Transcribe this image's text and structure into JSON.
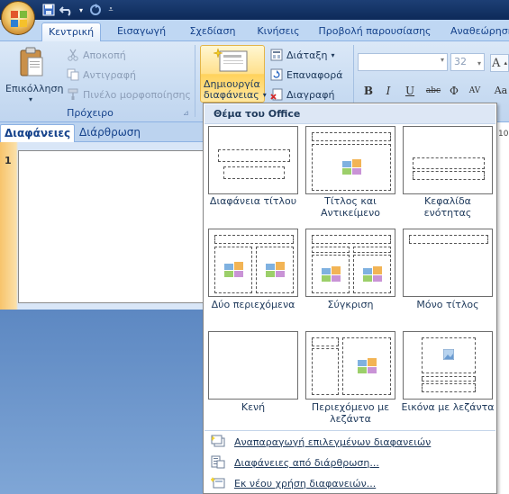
{
  "tabs": [
    {
      "label": "Κεντρική",
      "active": true
    },
    {
      "label": "Εισαγωγή"
    },
    {
      "label": "Σχεδίαση"
    },
    {
      "label": "Κινήσεις"
    },
    {
      "label": "Προβολή παρουσίασης"
    },
    {
      "label": "Αναθεώρηση"
    }
  ],
  "clipboard": {
    "paste_label": "Επικόλληση",
    "cut_label": "Αποκοπή",
    "copy_label": "Αντιγραφή",
    "format_painter_label": "Πινέλο μορφοποίησης",
    "group_label": "Πρόχειρο"
  },
  "slides": {
    "new_slide_label_line1": "Δημιουργία",
    "new_slide_label_line2": "διαφάνειας",
    "layout_label": "Διάταξη",
    "reset_label": "Επαναφορά",
    "delete_label": "Διαγραφή"
  },
  "font": {
    "name_value": "",
    "size_value": "32",
    "bold": "B",
    "italic": "I",
    "underline": "U",
    "strike": "abc",
    "shadow": "S",
    "spacing": "AV",
    "case": "Aa"
  },
  "left_panel": {
    "tab_slides": "Διαφάνειες",
    "tab_outline": "Διάρθρωση",
    "slide_number": "1"
  },
  "ruler_value": "10",
  "dropdown": {
    "header": "Θέμα του Office",
    "layouts": [
      {
        "label": "Διαφάνεια τίτλου"
      },
      {
        "label": "Τίτλος και Αντικείμενο"
      },
      {
        "label": "Κεφαλίδα ενότητας"
      },
      {
        "label": "Δύο περιεχόμενα"
      },
      {
        "label": "Σύγκριση"
      },
      {
        "label": "Μόνο τίτλος"
      },
      {
        "label": "Κενή"
      },
      {
        "label": "Περιεχόμενο με λεζάντα"
      },
      {
        "label": "Εικόνα με λεζάντα"
      }
    ],
    "menu": [
      {
        "label": "Αναπαραγωγή επιλεγμένων διαφανειών"
      },
      {
        "label": "Διαφάνειες από διάρθρωση..."
      },
      {
        "label": "Εκ νέου χρήση διαφανειών..."
      }
    ]
  },
  "colors": {
    "accent": "#15428b",
    "ribbon_bg": "#c9dcf2",
    "highlight": "#ffe08c",
    "left_panel": "#6a93c8"
  }
}
